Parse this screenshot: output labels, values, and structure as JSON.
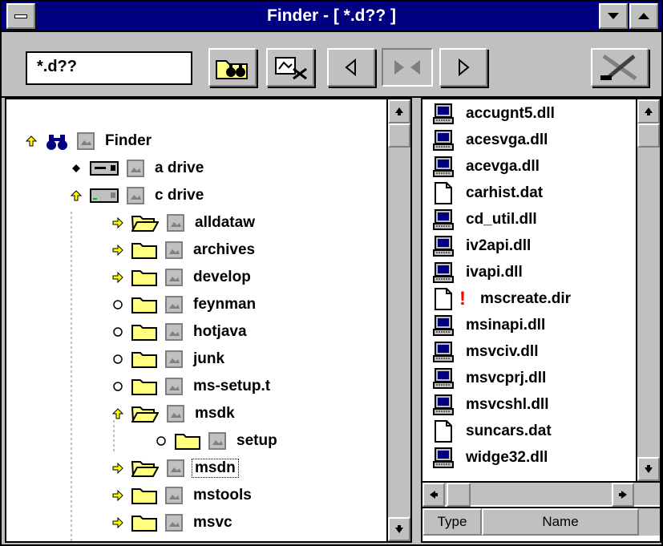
{
  "window": {
    "title": "Finder - [ *.d?? ]"
  },
  "toolbar": {
    "search_value": "*.d??"
  },
  "tree": [
    {
      "label": "Finder",
      "icon": "binoculars-icon",
      "control": "up-arrow",
      "indent": 0
    },
    {
      "label": "a drive",
      "icon": "floppy-drive-icon",
      "control": "diamond",
      "indent": 1
    },
    {
      "label": "c drive",
      "icon": "hard-drive-icon",
      "control": "up-arrow",
      "indent": 1
    },
    {
      "label": "alldataw",
      "icon": "open-folder-icon",
      "control": "right-arrow",
      "indent": 2
    },
    {
      "label": "archives",
      "icon": "folder-icon",
      "control": "right-arrow",
      "indent": 2
    },
    {
      "label": "develop",
      "icon": "folder-icon",
      "control": "right-arrow",
      "indent": 2
    },
    {
      "label": "feynman",
      "icon": "folder-icon",
      "control": "circle",
      "indent": 2
    },
    {
      "label": "hotjava",
      "icon": "folder-icon",
      "control": "circle",
      "indent": 2
    },
    {
      "label": "junk",
      "icon": "folder-icon",
      "control": "circle",
      "indent": 2
    },
    {
      "label": "ms-setup.t",
      "icon": "folder-icon",
      "control": "circle",
      "indent": 2
    },
    {
      "label": "msdk",
      "icon": "open-folder-icon",
      "control": "up-arrow",
      "indent": 2
    },
    {
      "label": "setup",
      "icon": "folder-icon",
      "control": "circle",
      "indent": 3
    },
    {
      "label": "msdn",
      "icon": "open-folder-icon",
      "control": "right-arrow",
      "indent": 2,
      "focused": true
    },
    {
      "label": "mstools",
      "icon": "folder-icon",
      "control": "right-arrow",
      "indent": 2
    },
    {
      "label": "msvc",
      "icon": "folder-icon",
      "control": "right-arrow",
      "indent": 2
    }
  ],
  "files": [
    {
      "name": "accugnt5.dll",
      "icon": "computer-file-icon"
    },
    {
      "name": "acesvga.dll",
      "icon": "computer-file-icon"
    },
    {
      "name": "acevga.dll",
      "icon": "computer-file-icon"
    },
    {
      "name": "carhist.dat",
      "icon": "document-icon"
    },
    {
      "name": "cd_util.dll",
      "icon": "computer-file-icon"
    },
    {
      "name": "iv2api.dll",
      "icon": "computer-file-icon"
    },
    {
      "name": "ivapi.dll",
      "icon": "computer-file-icon"
    },
    {
      "name": "mscreate.dir",
      "icon": "document-icon",
      "warning": true
    },
    {
      "name": "msinapi.dll",
      "icon": "computer-file-icon"
    },
    {
      "name": "msvciv.dll",
      "icon": "computer-file-icon"
    },
    {
      "name": "msvcprj.dll",
      "icon": "computer-file-icon"
    },
    {
      "name": "msvcshl.dll",
      "icon": "computer-file-icon"
    },
    {
      "name": "suncars.dat",
      "icon": "document-icon"
    },
    {
      "name": "widge32.dll",
      "icon": "computer-file-icon"
    }
  ],
  "columns": {
    "type_label": "Type",
    "name_label": "Name"
  },
  "colors": {
    "titlebar": "#000080",
    "face": "#c0c0c0",
    "folder": "#ffff80",
    "warning": "#ff0000"
  }
}
